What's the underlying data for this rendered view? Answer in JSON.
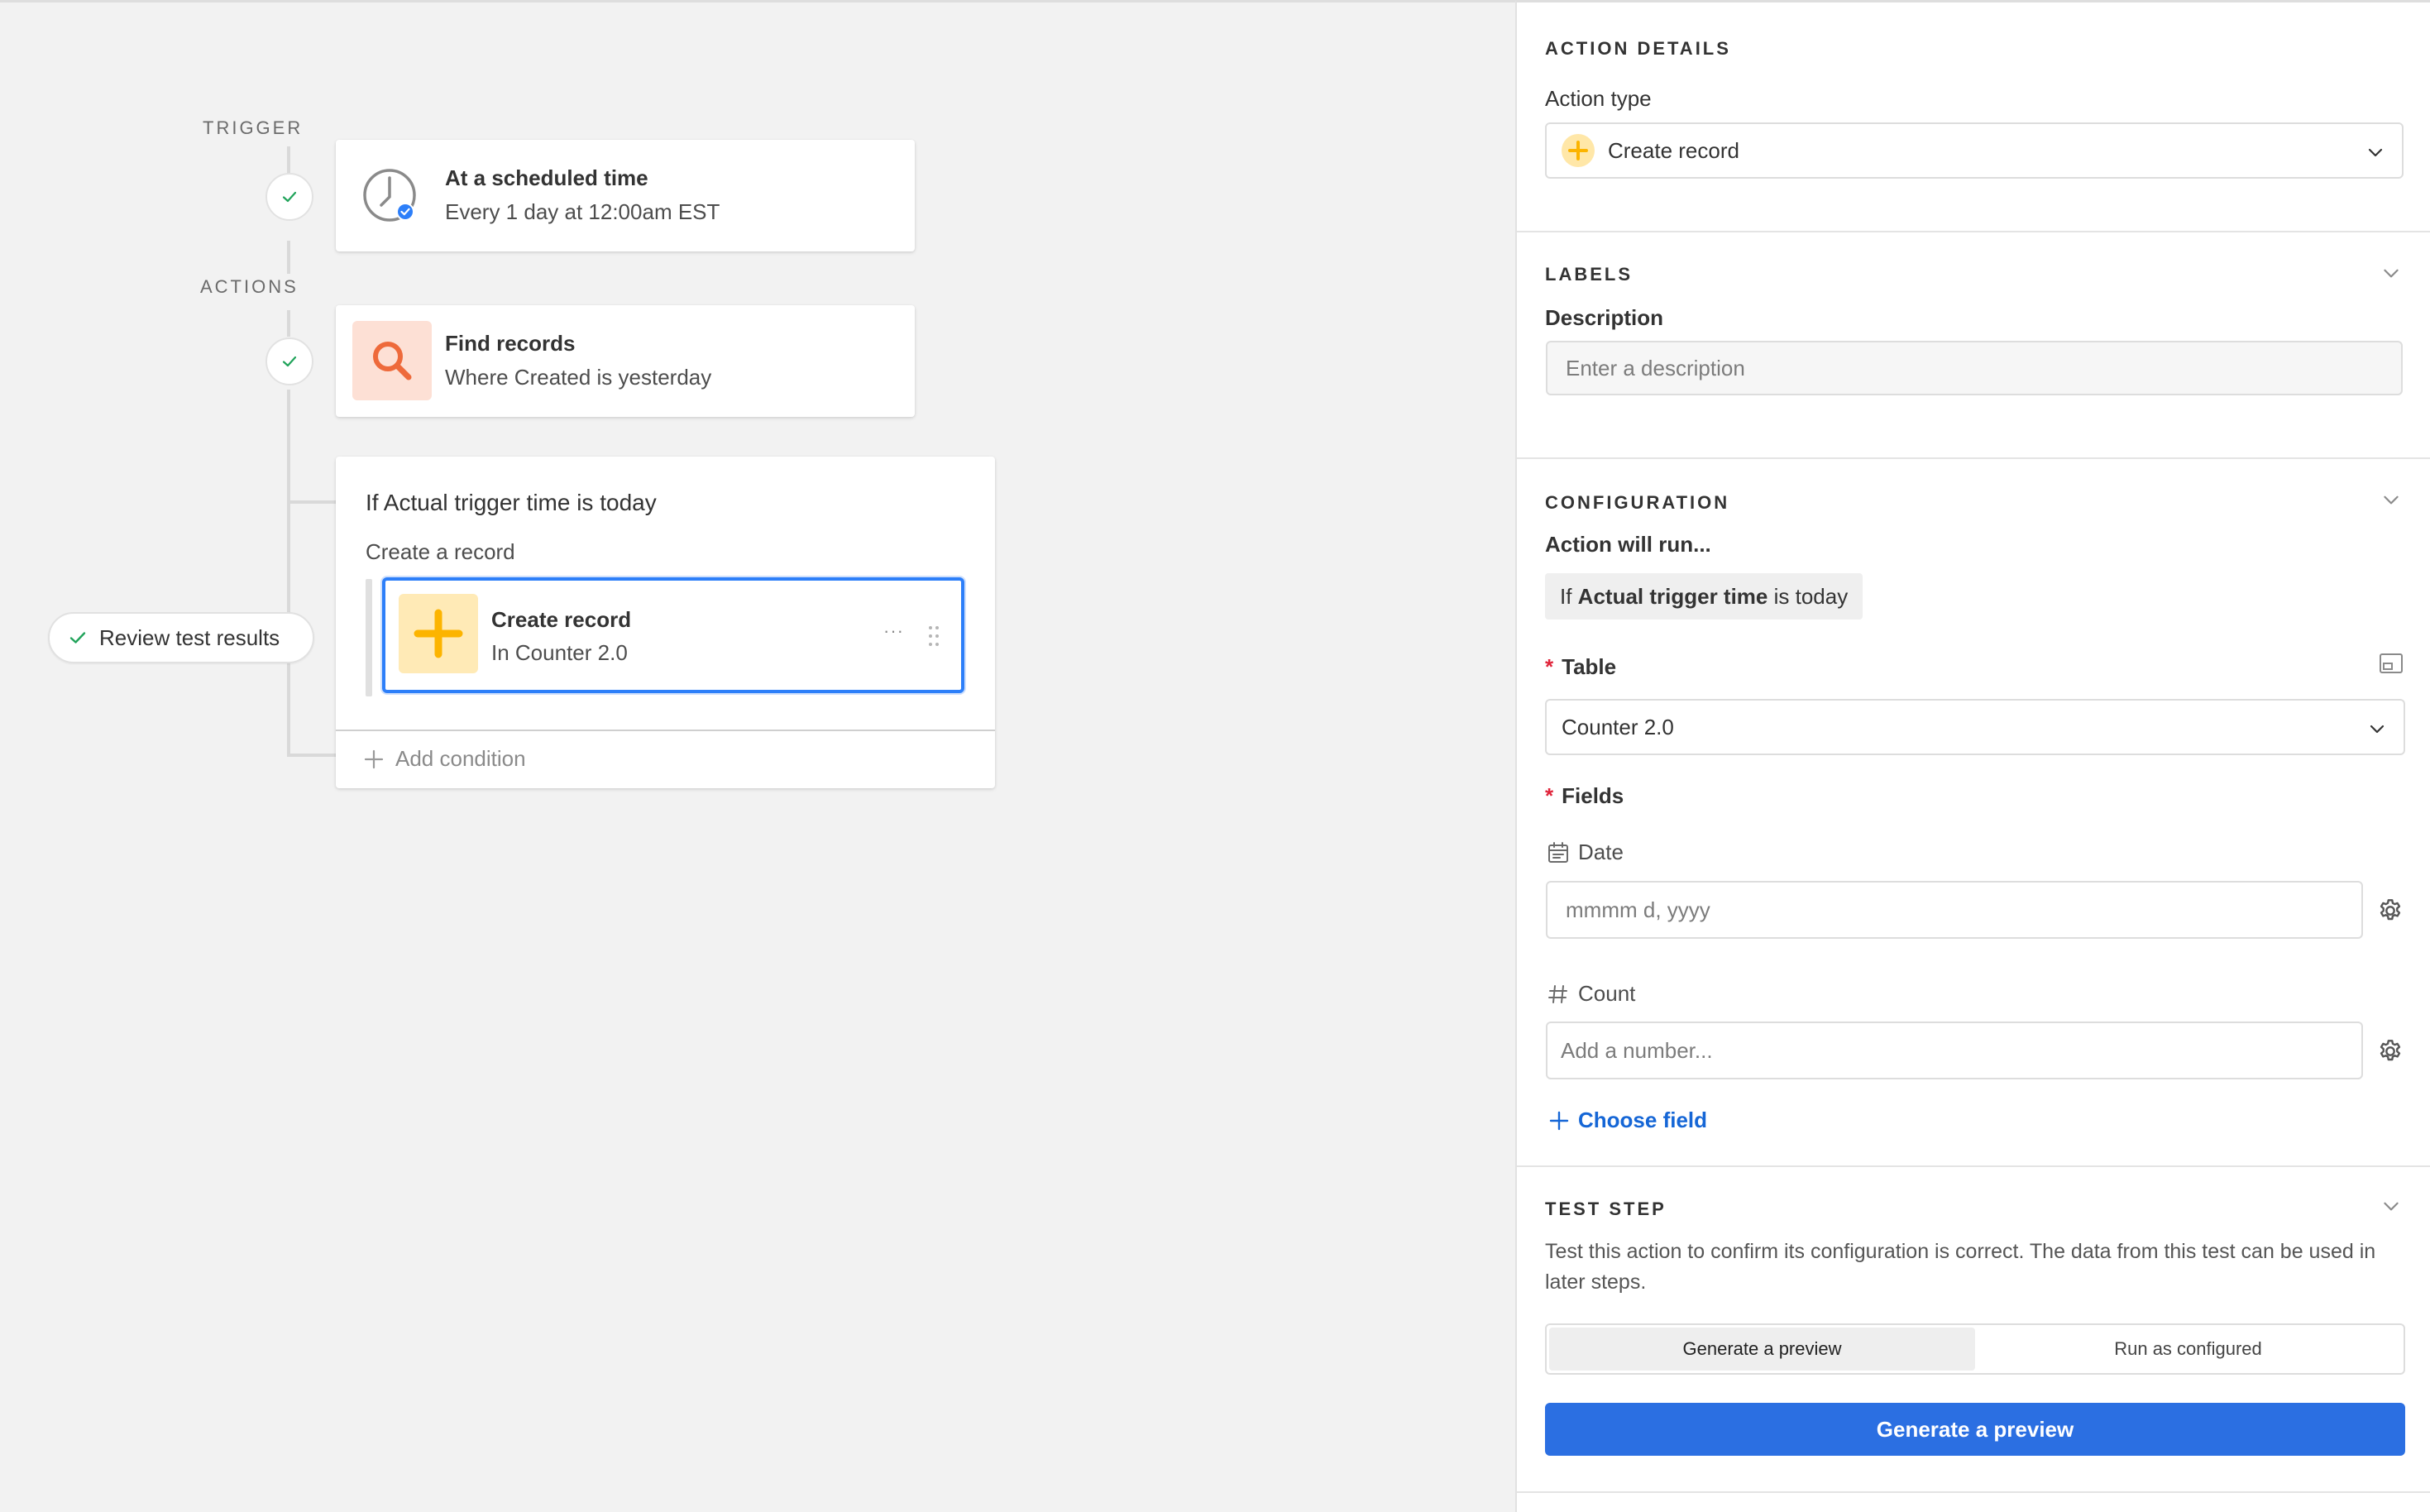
{
  "canvas": {
    "trigger_label": "TRIGGER",
    "actions_label": "ACTIONS",
    "trigger_card": {
      "title": "At a scheduled time",
      "subtitle": "Every 1 day at 12:00am EST",
      "icon": "clock-icon"
    },
    "find_card": {
      "title": "Find records",
      "subtitle": "Where Created is yesterday",
      "icon": "search-icon"
    },
    "condition_card": {
      "title": "If Actual trigger time is today",
      "branch_label": "Create a record",
      "action": {
        "title": "Create record",
        "subtitle": "In Counter 2.0",
        "more": "···"
      },
      "add_condition": "Add condition"
    },
    "review_button": "Review test results"
  },
  "panel": {
    "action_details": {
      "heading": "ACTION DETAILS",
      "action_type_label": "Action type",
      "action_type_value": "Create record"
    },
    "labels": {
      "heading": "LABELS",
      "description_label": "Description",
      "description_placeholder": "Enter a description",
      "description_value": ""
    },
    "configuration": {
      "heading": "CONFIGURATION",
      "runs_label": "Action will run...",
      "condition": {
        "prefix": "If ",
        "field": "Actual trigger time",
        "suffix": " is today"
      },
      "table_label": "Table",
      "table_value": "Counter 2.0",
      "fields_label": "Fields",
      "fields": [
        {
          "name": "Date",
          "icon": "calendar-icon",
          "placeholder": "mmmm d, yyyy"
        },
        {
          "name": "Count",
          "icon": "hash-icon",
          "placeholder": "Add a number..."
        }
      ],
      "choose_field": "Choose field"
    },
    "test_step": {
      "heading": "TEST STEP",
      "description": "Test this action to confirm its configuration is correct. The data from this test can be used in later steps.",
      "tabs": [
        "Generate a preview",
        "Run as configured"
      ],
      "active_tab": 0,
      "primary_button": "Generate a preview"
    }
  },
  "colors": {
    "accent_blue": "#2d7ff9",
    "primary_button": "#2b6fe2",
    "required": "#e0243a",
    "link_blue": "#1566d6",
    "search_orange": "#ee6a3b",
    "plus_yellow": "#fcb400",
    "check_green": "#20a35a"
  }
}
